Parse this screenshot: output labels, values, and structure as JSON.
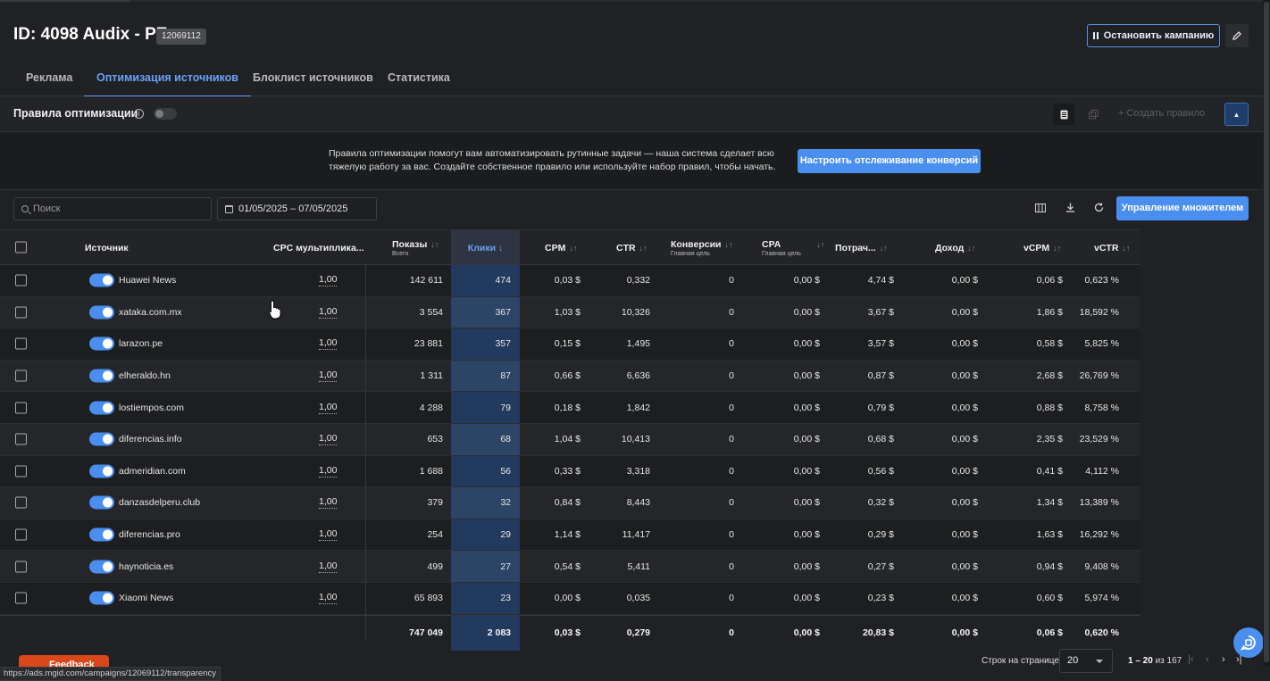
{
  "header": {
    "title": "ID: 4098 Audix - PE",
    "campaign_id": "12069112",
    "stop_button": "Остановить кампанию",
    "edit_icon": "pencil-icon"
  },
  "tabs": [
    {
      "label": "Реклама",
      "active": false
    },
    {
      "label": "Оптимизация источников",
      "active": true
    },
    {
      "label": "Блоклист источников",
      "active": false
    },
    {
      "label": "Статистика",
      "active": false
    }
  ],
  "rules": {
    "title": "Правила оптимизации",
    "info_icon": "i",
    "create_rule": "+ Создать правило",
    "enabled": false
  },
  "banner": {
    "text": "Правила оптимизации помогут вам автоматизировать рутинные задачи — наша система сделает всю тяжелую работу за вас. Создайте собственное правило или используйте набор правил, чтобы начать.",
    "button": "Настроить отслеживание конверсий"
  },
  "toolbar": {
    "search_placeholder": "Поиск",
    "date_range": "01/05/2025 – 07/05/2025",
    "multiplier_button": "Управление множителем"
  },
  "table": {
    "columns": {
      "source": "Источник",
      "cpc": "CPC мультипликa...",
      "impressions": "Показы",
      "impressions_sub": "Всего",
      "clicks": "Клики",
      "cpm": "CPM",
      "ctr": "CTR",
      "conversions": "Конверсии",
      "conversions_sub": "Главная цель",
      "cpa": "CPA",
      "cpa_sub": "Главная цель",
      "spent": "Потрач...",
      "revenue": "Доход",
      "vcpm": "vCPM",
      "vctr": "vCTR"
    },
    "rows": [
      {
        "source": "Huawei News",
        "cpc": "1,00",
        "impressions": "142 611",
        "clicks": "474",
        "cpm": "0,03 $",
        "ctr": "0,332",
        "conv": "0",
        "cpa": "0,00 $",
        "spent": "4,74 $",
        "revenue": "0,00 $",
        "vcpm": "0,06 $",
        "vctr": "0,623 %"
      },
      {
        "source": "xataka.com.mx",
        "cpc": "1,00",
        "impressions": "3 554",
        "clicks": "367",
        "cpm": "1,03 $",
        "ctr": "10,326",
        "conv": "0",
        "cpa": "0,00 $",
        "spent": "3,67 $",
        "revenue": "0,00 $",
        "vcpm": "1,86 $",
        "vctr": "18,592 %"
      },
      {
        "source": "larazon.pe",
        "cpc": "1,00",
        "impressions": "23 881",
        "clicks": "357",
        "cpm": "0,15 $",
        "ctr": "1,495",
        "conv": "0",
        "cpa": "0,00 $",
        "spent": "3,57 $",
        "revenue": "0,00 $",
        "vcpm": "0,58 $",
        "vctr": "5,825 %"
      },
      {
        "source": "elheraldo.hn",
        "cpc": "1,00",
        "impressions": "1 311",
        "clicks": "87",
        "cpm": "0,66 $",
        "ctr": "6,636",
        "conv": "0",
        "cpa": "0,00 $",
        "spent": "0,87 $",
        "revenue": "0,00 $",
        "vcpm": "2,68 $",
        "vctr": "26,769 %"
      },
      {
        "source": "lostiempos.com",
        "cpc": "1,00",
        "impressions": "4 288",
        "clicks": "79",
        "cpm": "0,18 $",
        "ctr": "1,842",
        "conv": "0",
        "cpa": "0,00 $",
        "spent": "0,79 $",
        "revenue": "0,00 $",
        "vcpm": "0,88 $",
        "vctr": "8,758 %"
      },
      {
        "source": "diferencias.info",
        "cpc": "1,00",
        "impressions": "653",
        "clicks": "68",
        "cpm": "1,04 $",
        "ctr": "10,413",
        "conv": "0",
        "cpa": "0,00 $",
        "spent": "0,68 $",
        "revenue": "0,00 $",
        "vcpm": "2,35 $",
        "vctr": "23,529 %"
      },
      {
        "source": "admeridian.com",
        "cpc": "1,00",
        "impressions": "1 688",
        "clicks": "56",
        "cpm": "0,33 $",
        "ctr": "3,318",
        "conv": "0",
        "cpa": "0,00 $",
        "spent": "0,56 $",
        "revenue": "0,00 $",
        "vcpm": "0,41 $",
        "vctr": "4,112 %"
      },
      {
        "source": "danzasdelperu.club",
        "cpc": "1,00",
        "impressions": "379",
        "clicks": "32",
        "cpm": "0,84 $",
        "ctr": "8,443",
        "conv": "0",
        "cpa": "0,00 $",
        "spent": "0,32 $",
        "revenue": "0,00 $",
        "vcpm": "1,34 $",
        "vctr": "13,389 %"
      },
      {
        "source": "diferencias.pro",
        "cpc": "1,00",
        "impressions": "254",
        "clicks": "29",
        "cpm": "1,14 $",
        "ctr": "11,417",
        "conv": "0",
        "cpa": "0,00 $",
        "spent": "0,29 $",
        "revenue": "0,00 $",
        "vcpm": "1,63 $",
        "vctr": "16,292 %"
      },
      {
        "source": "haynoticia.es",
        "cpc": "1,00",
        "impressions": "499",
        "clicks": "27",
        "cpm": "0,54 $",
        "ctr": "5,411",
        "conv": "0",
        "cpa": "0,00 $",
        "spent": "0,27 $",
        "revenue": "0,00 $",
        "vcpm": "0,94 $",
        "vctr": "9,408 %"
      },
      {
        "source": "Xiaomi News",
        "cpc": "1,00",
        "impressions": "65 893",
        "clicks": "23",
        "cpm": "0,00 $",
        "ctr": "0,035",
        "conv": "0",
        "cpa": "0,00 $",
        "spent": "0,23 $",
        "revenue": "0,00 $",
        "vcpm": "0,60 $",
        "vctr": "5,974 %"
      }
    ],
    "totals": {
      "impressions": "747 049",
      "clicks": "2 083",
      "cpm": "0,03 $",
      "ctr": "0,279",
      "conv": "0",
      "cpa": "0,00 $",
      "spent": "20,83 $",
      "revenue": "0,00 $",
      "vcpm": "0,06 $",
      "vctr": "0,620 %"
    }
  },
  "footer": {
    "feedback": "Feedback",
    "status_url": "https://ads.mgid.com/campaigns/12069112/transparency",
    "rows_per_page_label": "Строк на странице:",
    "rows_per_page": "20",
    "range": "1 – 20",
    "range_of": "из 167"
  },
  "colors": {
    "accent": "#4a8ff0",
    "background": "#202124",
    "clicks_column": "#223a5e",
    "feedback": "#d9481a"
  }
}
